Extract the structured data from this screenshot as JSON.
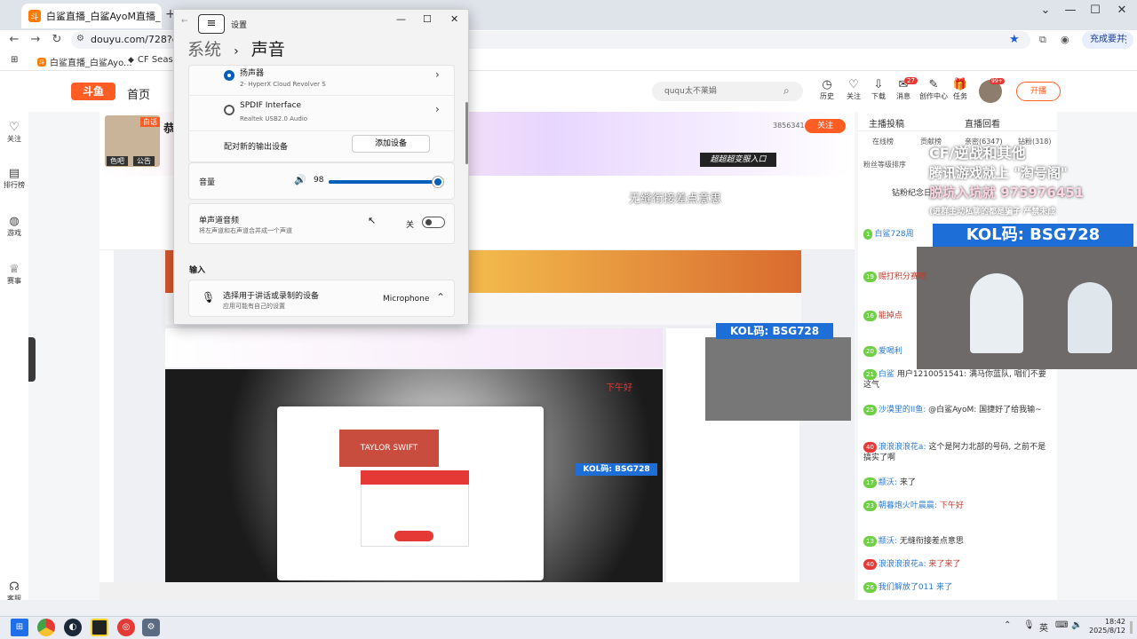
{
  "browser": {
    "tab_title": "白鲨直播_白鲨AyoM直播_白鲨",
    "favicon": "斗",
    "url": "douyu.com/728?dys",
    "bookmarks": [
      {
        "icon": "grid-icon",
        "label": ""
      },
      {
        "icon": "douyu-icon",
        "label": "白鲨直播_白鲨Ayo..."
      },
      {
        "icon": "cf-icon",
        "label": "CF Seaso"
      }
    ],
    "profile_label": "充成要并"
  },
  "douyu": {
    "logo": "斗鱼",
    "nav_home": "首页",
    "search_placeholder": "ququ太不莱娟",
    "header_icons": [
      {
        "icon": "clock-icon",
        "label": "历史"
      },
      {
        "icon": "heart-icon",
        "label": "关注"
      },
      {
        "icon": "download-icon",
        "label": "下载"
      },
      {
        "icon": "bell-icon",
        "label": "消息",
        "count": "27"
      },
      {
        "icon": "bulb-icon",
        "label": "创作中心"
      },
      {
        "icon": "gift-icon",
        "label": "任务"
      }
    ],
    "avatar_badge": "99+",
    "live_button": "开播",
    "left_rail": [
      {
        "icon": "heart-icon",
        "label": "关注"
      },
      {
        "icon": "rank-icon",
        "label": "排行榜"
      },
      {
        "icon": "game-icon",
        "label": "游戏"
      },
      {
        "icon": "trophy-icon",
        "label": "赛事"
      },
      {
        "icon": "headset-icon",
        "label": "客服"
      }
    ],
    "anchor": {
      "name": "恭",
      "tag1": "色吧",
      "tag2": "公告",
      "roomid": "3856341",
      "follow": "关注",
      "banner": "超超超变服入口",
      "tag_white": "白话"
    },
    "overlay": {
      "line1": "CF/逆战和其他",
      "line2": "腾讯游戏就上 \"淘号阁\"",
      "line3": "脱坑入坑就 975976451",
      "line4": "(进群主动私聊的都是骗子 严禁未成",
      "kol": "KOL码: BSG728"
    },
    "chat": {
      "tabs_head": [
        "主播投稿",
        "直播回看"
      ],
      "tabs": [
        "在线榜",
        "贡献榜",
        "亲密(6347)",
        "钻粉(318)"
      ],
      "sort_label": "粉丝等级排序",
      "top_item": "钻粉纪念日",
      "rows": [
        {
          "lv": "1",
          "name": "白鲨728周"
        },
        {
          "lv": "19",
          "name": "",
          "msg": "赐打积分赛吧"
        },
        {
          "lv": "16",
          "name": "",
          "msg": "能掉点"
        },
        {
          "lv": "20",
          "name": "爱喝利",
          "msg": ""
        },
        {
          "lv": "21",
          "name": "白鲨",
          "msg": "用户1210051541: 满马你蓝队, 唱们不要这气"
        },
        {
          "lv": "25",
          "name": "沙漠里的II鱼",
          "msg": "@白鲨AyoM: 国捷好了给我输~"
        },
        {
          "lv": "40",
          "name": "浪浪浪浪花a",
          "msg": "这个是阿力北部的号码, 之前不是搞实了啊"
        },
        {
          "lv": "17",
          "name": "颛沃",
          "msg": "来了"
        },
        {
          "lv": "23",
          "name": "朝暮炮火叶晨晨",
          "msg": "下午好"
        },
        {
          "lv": "13",
          "name": "颛沃",
          "msg": "无缝衔接差点意思"
        },
        {
          "lv": "40",
          "name": "浪浪浪浪花a",
          "msg": "来了来了"
        },
        {
          "lv": "26",
          "name": "",
          "msg": "我们解放了011 来了"
        }
      ]
    },
    "video_caption": "无缝衔接差点意思",
    "nested_overlay_caption": "下午好"
  },
  "settings": {
    "window_title": "设置",
    "crumb_parent": "系统",
    "crumb_sep": "›",
    "crumb_current": "声音",
    "devices": [
      {
        "name": "扬声器",
        "sub": "2- HyperX Cloud Revolver S",
        "selected": true
      },
      {
        "name": "SPDIF Interface",
        "sub": "Realtek USB2.0 Audio",
        "selected": false
      }
    ],
    "pair_label": "配对新的输出设备",
    "add_device": "添加设备",
    "volume_label": "音量",
    "volume_value": "98",
    "volume_level": 0.98,
    "mono_title": "单声道音频",
    "mono_sub": "将左声道和右声道合并成一个声道",
    "mono_state": "关",
    "input_header": "输入",
    "input_title": "选择用于讲话或录制的设备",
    "input_sub": "应用可能有自己的设置",
    "input_value": "Microphone"
  },
  "taskbar": {
    "icons": [
      "windows-icon",
      "chrome-icon",
      "steam-icon",
      "app-icon",
      "netease-icon",
      "settings-icon"
    ],
    "lang": "英",
    "time": "18:42",
    "date": "2025/8/12"
  }
}
